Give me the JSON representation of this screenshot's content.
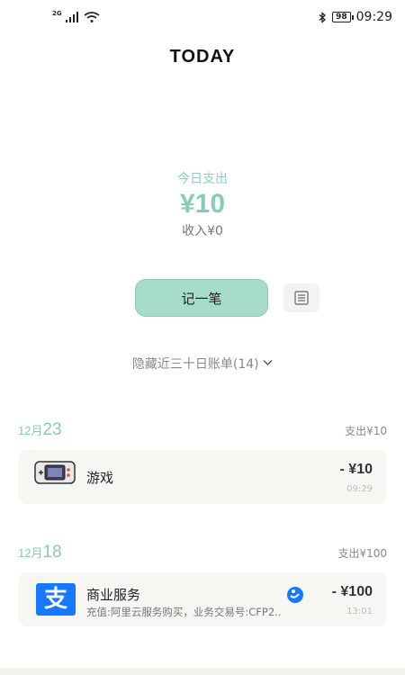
{
  "status_bar": {
    "network": "2G",
    "battery": "98",
    "time": "09:29"
  },
  "app_title": "TODAY",
  "summary": {
    "label": "今日支出",
    "amount": "¥10",
    "income": "收入¥0"
  },
  "actions": {
    "record_label": "记一笔",
    "list_icon": "list-icon"
  },
  "history_toggle": "隐藏近三十日账单(14)",
  "days": [
    {
      "month": "12月",
      "day": "23",
      "total": "支出¥10",
      "entries": [
        {
          "icon": "game-console-icon",
          "title": "游戏",
          "subtitle": "",
          "amount": "- ¥10",
          "time": "09:29"
        }
      ]
    },
    {
      "month": "12月",
      "day": "18",
      "total": "支出¥100",
      "entries": [
        {
          "icon": "alipay-icon",
          "title": "商业服务",
          "subtitle": "充值:阿里云服务购买，业务交易号:CFP2..",
          "amount": "- ¥100",
          "time": "13:01",
          "pay_method_icon": "alipay-method-icon",
          "icon_char": "支"
        }
      ]
    }
  ],
  "colors": {
    "accent": "#86cdb8",
    "button": "#a7dccb",
    "card": "#f6f6f2"
  }
}
